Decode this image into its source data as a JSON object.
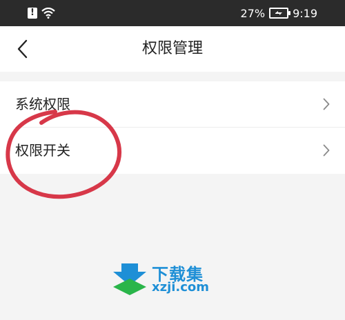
{
  "status_bar": {
    "battery_percent": "27%",
    "time": "9:19",
    "icons": [
      "alert-icon",
      "wifi-icon",
      "battery-charging-icon"
    ]
  },
  "header": {
    "title": "权限管理",
    "back_icon": "chevron-left-icon"
  },
  "settings": {
    "items": [
      {
        "label": "系统权限",
        "icon": "chevron-right-icon"
      },
      {
        "label": "权限开关",
        "icon": "chevron-right-icon"
      }
    ]
  },
  "annotation": {
    "color": "#d4273a"
  },
  "watermark": {
    "title": "下载集",
    "domain": "xzji.com",
    "color": "#1e8fd6",
    "accent": "#2ab54a"
  }
}
